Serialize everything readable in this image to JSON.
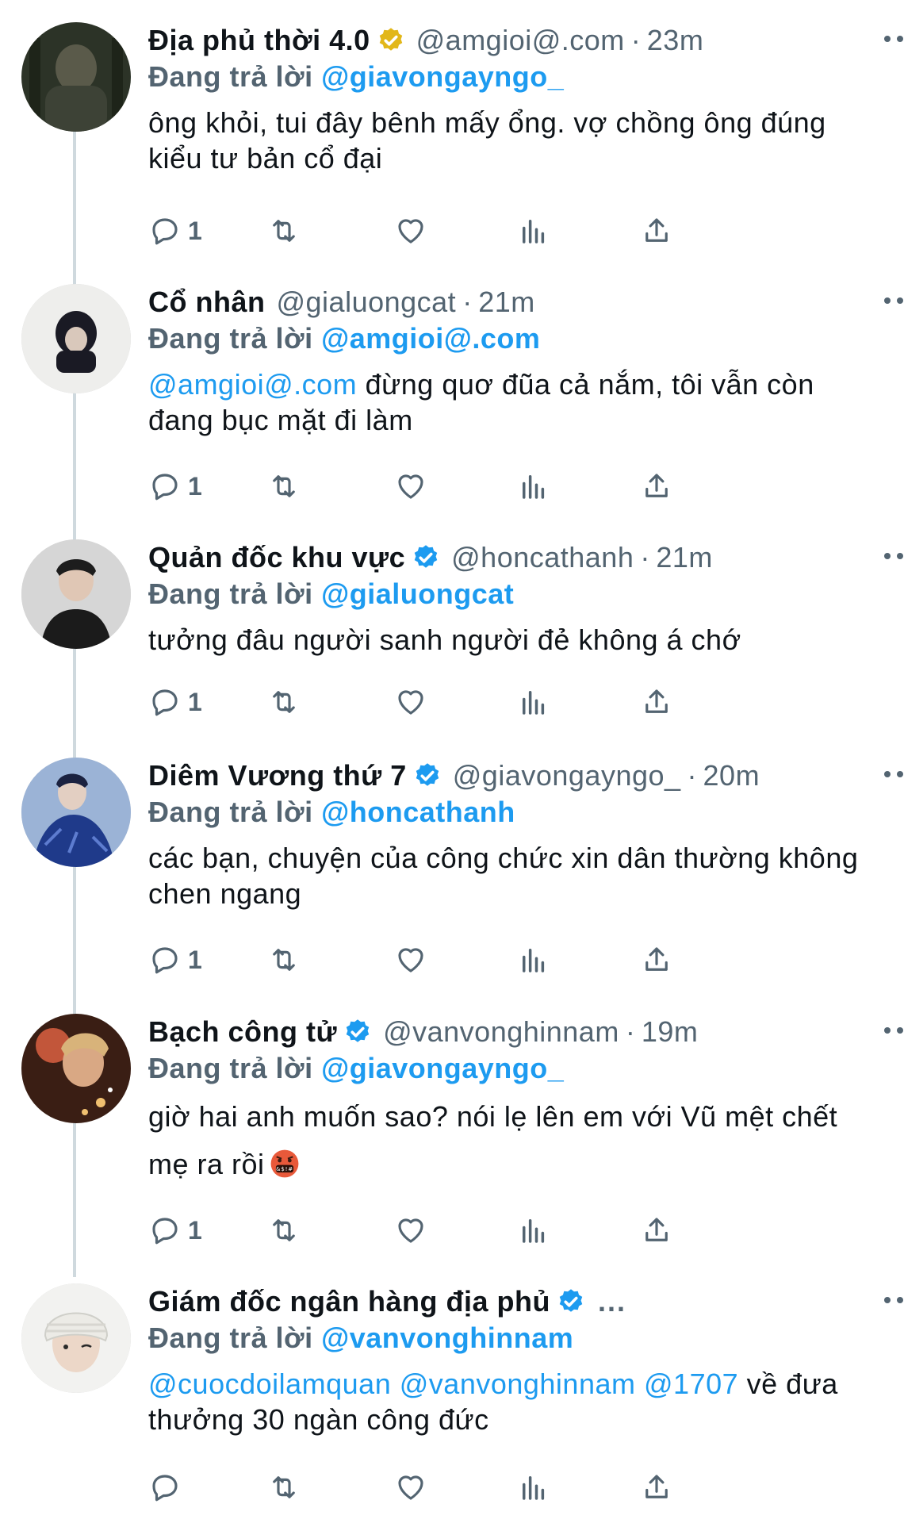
{
  "colors": {
    "link": "#1d9bf0",
    "secondary": "#536471",
    "verified": "#1d9bf0",
    "gold_badge": "#e2b719",
    "thread_line": "#cfd9de"
  },
  "tweets": [
    {
      "name": "Địa phủ thời 4.0",
      "badge": "gold-verified-icon",
      "handle": "@amgioi@.com",
      "sep": "·",
      "time": "23m",
      "reply_prefix": "Đang trả lời",
      "reply_to": "@giavongayngo_",
      "text": "ông khỏi, tui đây bênh mấy ổng. vợ chồng ông đúng kiểu tư bản cổ đại",
      "reply_count": "1"
    },
    {
      "name": "Cổ nhân",
      "handle": "@gialuongcat",
      "sep": "·",
      "time": "21m",
      "reply_prefix": "Đang trả lời",
      "reply_to": "@amgioi@.com",
      "mention": "@amgioi@.com",
      "text": " đừng quơ đũa cả nắm, tôi vẫn còn đang bục mặt đi làm",
      "reply_count": "1"
    },
    {
      "name": "Quản đốc khu vực",
      "badge": "verified-icon",
      "handle": "@honcathanh",
      "sep": "·",
      "time": "21m",
      "reply_prefix": "Đang trả lời",
      "reply_to": "@gialuongcat",
      "text": "tưởng đâu người sanh người đẻ không á chớ",
      "reply_count": "1"
    },
    {
      "name": "Diêm Vương thứ 7",
      "badge": "verified-icon",
      "handle": "@giavongayngo_",
      "sep": "·",
      "time": "20m",
      "reply_prefix": "Đang trả lời",
      "reply_to": "@honcathanh",
      "text": "các bạn, chuyện của công chức xin dân thường không chen ngang",
      "reply_count": "1"
    },
    {
      "name": "Bạch công tử",
      "badge": "verified-icon",
      "handle": "@vanvonghinnam",
      "sep": "·",
      "time": "19m",
      "reply_prefix": "Đang trả lời",
      "reply_to": "@giavongayngo_",
      "text": "giờ hai anh muốn sao? nói lẹ lên em với Vũ mệt chết mẹ ra rồi",
      "emoji": "face-with-symbols-on-mouth-emoji",
      "reply_count": "1"
    },
    {
      "name": "Giám đốc ngân hàng địa phủ",
      "badge": "verified-icon",
      "truncation": "...",
      "reply_prefix": "Đang trả lời",
      "reply_to": "@vanvonghinnam",
      "mentions": [
        "@cuocdoilamquan",
        "@vanvonghinnam",
        "@1707"
      ],
      "text": " về đưa thưởng 30 ngàn công đức",
      "reply_count": ""
    }
  ]
}
